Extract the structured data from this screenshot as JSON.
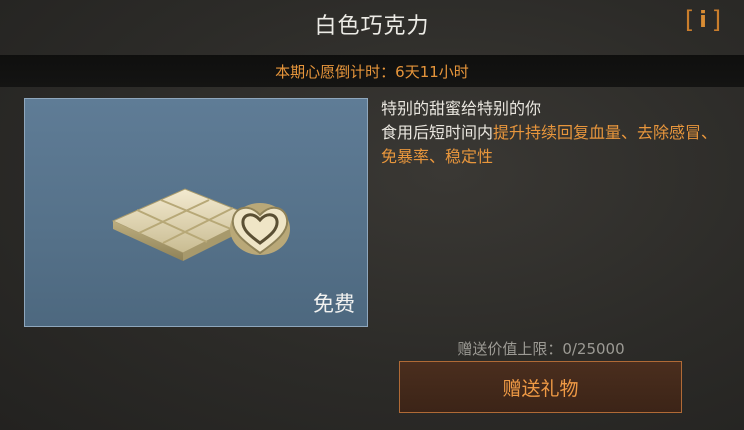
{
  "header": {
    "title": "白色巧克力",
    "info_label": "i"
  },
  "countdown": {
    "text": "本期心愿倒计时：6天11小时"
  },
  "item": {
    "price_label": "免费",
    "description_line1": "特别的甜蜜给特别的你",
    "description_prefix": "食用后短时间内",
    "description_effects": "提升持续回复血量、去除感冒、免暴率、稳定性"
  },
  "gift": {
    "limit_text": "赠送价值上限：0/25000",
    "button_label": "赠送礼物"
  },
  "colors": {
    "accent": "#e8963c",
    "panel": "#5a7690",
    "button_bg": "#42291b"
  }
}
